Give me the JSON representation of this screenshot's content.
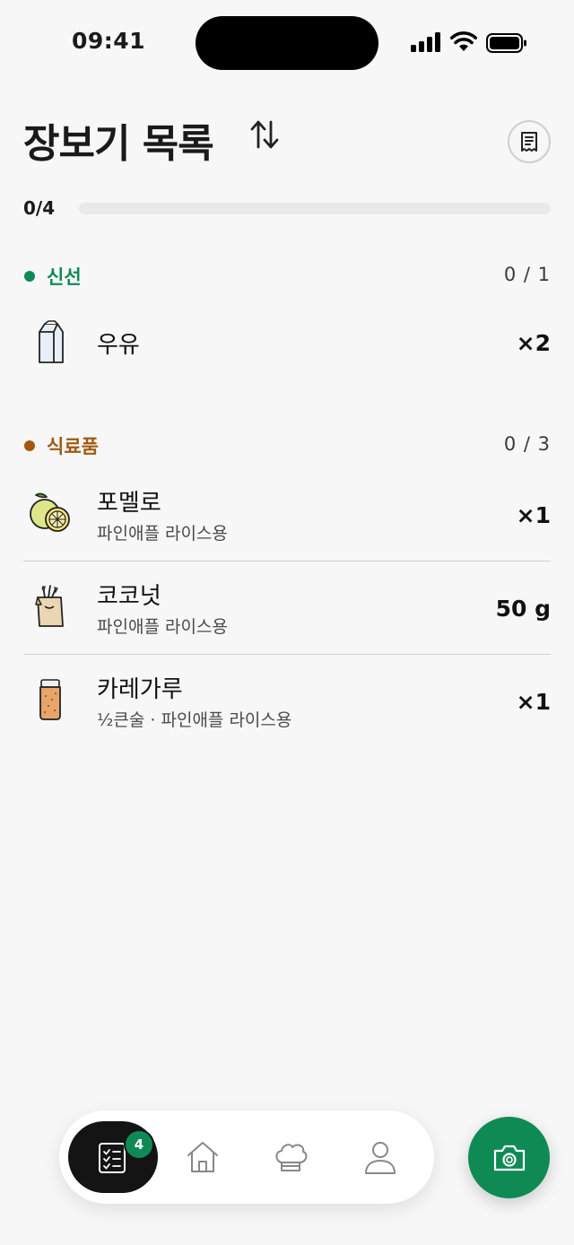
{
  "status_bar": {
    "time": "09:41"
  },
  "header": {
    "title": "장보기 목록"
  },
  "progress": {
    "label": "0/4",
    "fraction": 0
  },
  "sections": [
    {
      "name": "신선",
      "count": "0 / 1",
      "color": "#0f8a55",
      "items": [
        {
          "name": "우유",
          "note": "",
          "qty": "×2",
          "icon": "milk-carton-icon"
        }
      ]
    },
    {
      "name": "식료품",
      "count": "0 / 3",
      "color": "#a05a10",
      "items": [
        {
          "name": "포멜로",
          "note": "파인애플 라이스용",
          "qty": "×1",
          "icon": "pomelo-icon"
        },
        {
          "name": "코코넛",
          "note": "파인애플 라이스용",
          "qty": "50 g",
          "icon": "grocery-bag-icon"
        },
        {
          "name": "카레가루",
          "note": "½큰술 · 파인애플 라이스용",
          "qty": "×1",
          "icon": "spice-jar-icon"
        }
      ]
    }
  ],
  "bottom_nav": {
    "badge": "4",
    "items": [
      "checklist-icon",
      "home-icon",
      "chef-hat-icon",
      "profile-icon"
    ]
  },
  "fab": {
    "icon": "camera-icon"
  },
  "colors": {
    "accent": "#0f8a55",
    "grocery": "#a05a10",
    "background": "#f7f7f7"
  }
}
